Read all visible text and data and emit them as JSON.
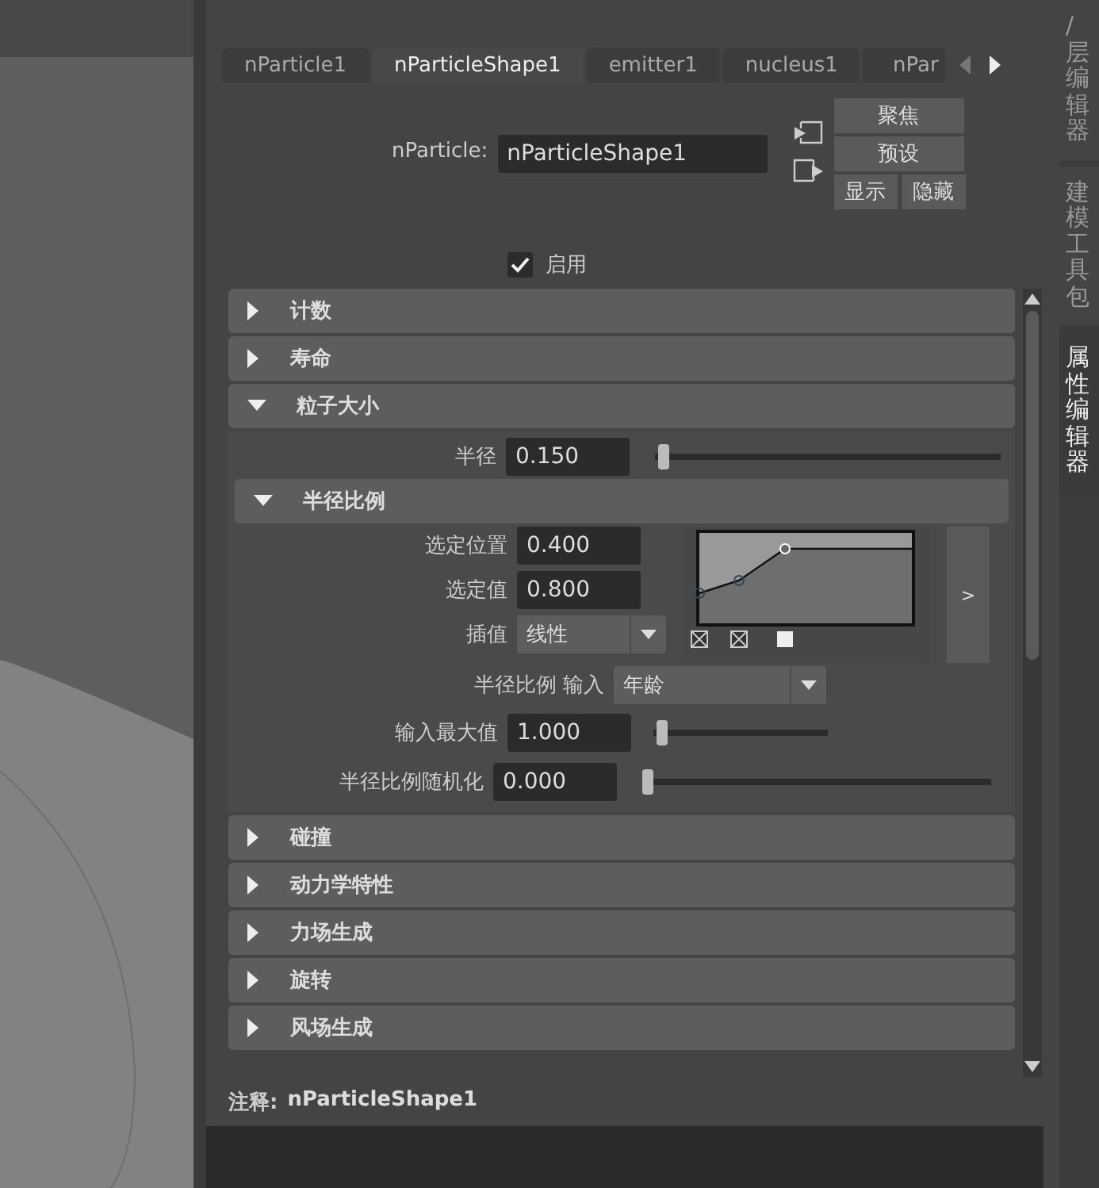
{
  "tabs": [
    {
      "label": "nParticle1",
      "selected": false
    },
    {
      "label": "nParticleShape1",
      "selected": true
    },
    {
      "label": "emitter1",
      "selected": false
    },
    {
      "label": "nucleus1",
      "selected": false
    },
    {
      "label": "nPar",
      "selected": false
    }
  ],
  "node": {
    "label": "nParticle:",
    "value": "nParticleShape1"
  },
  "buttons": [
    "聚焦",
    "预设",
    "显示",
    "隐藏"
  ],
  "enable": {
    "label": "启用",
    "checked": true
  },
  "sections": [
    {
      "title": "计数",
      "expanded": false
    },
    {
      "title": "寿命",
      "expanded": false
    },
    {
      "title": "粒子大小",
      "expanded": true,
      "radius": {
        "label": "半径",
        "value": "0.150",
        "level": 0.01
      },
      "radius_scale": {
        "title": "半径比例",
        "expanded": true,
        "selected_position": {
          "label": "选定位置",
          "value": "0.400"
        },
        "selected_value": {
          "label": "选定值",
          "value": "0.800"
        },
        "interpolation": {
          "label": "插值",
          "value": "线性"
        },
        "expand_button": ">",
        "input": {
          "label": "半径比例 输入",
          "value": "年龄"
        },
        "input_max": {
          "label": "输入最大值",
          "value": "1.000",
          "level": 0.02
        },
        "randomize": {
          "label": "半径比例随机化",
          "value": "0.000",
          "level": 0.0
        }
      }
    },
    {
      "title": "碰撞",
      "expanded": false
    },
    {
      "title": "动力学特性",
      "expanded": false
    },
    {
      "title": "力场生成",
      "expanded": false
    },
    {
      "title": "旋转",
      "expanded": false
    },
    {
      "title": "风场生成",
      "expanded": false
    }
  ],
  "notes": {
    "label": "注释:",
    "value": "nParticleShape1"
  },
  "side_tabs": [
    {
      "label": "/层编辑器",
      "selected": false
    },
    {
      "label": "建模工具包",
      "selected": false
    },
    {
      "label": "属性编辑器",
      "selected": true
    }
  ]
}
